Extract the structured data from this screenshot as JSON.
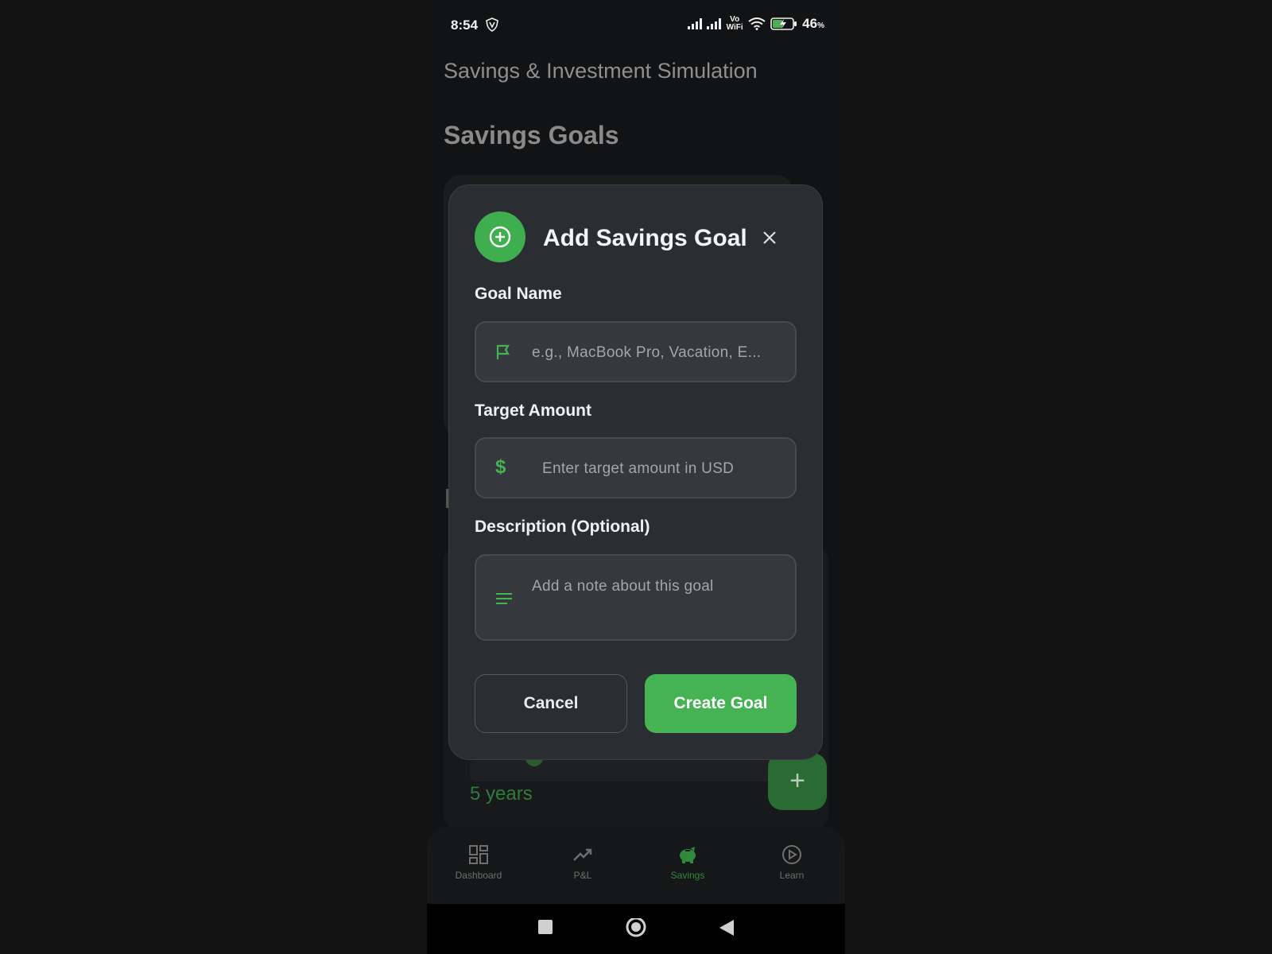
{
  "status_bar": {
    "time": "8:54",
    "battery": "46",
    "battery_unit": "%",
    "network": "Vo WiFi"
  },
  "page": {
    "title": "Savings & Investment Simulation",
    "section_title": "Savings Goals",
    "background_duration": "5 years"
  },
  "modal": {
    "title": "Add Savings Goal",
    "goal_name_label": "Goal Name",
    "goal_name_placeholder": "e.g., MacBook Pro, Vacation, E...",
    "target_amount_label": "Target Amount",
    "target_amount_placeholder": "Enter target amount in USD",
    "description_label": "Description (Optional)",
    "description_placeholder": "Add a note about this goal",
    "cancel_label": "Cancel",
    "create_label": "Create Goal"
  },
  "bottom_nav": {
    "items": [
      {
        "label": "Dashboard",
        "icon": "dashboard-icon",
        "active": false
      },
      {
        "label": "P&L",
        "icon": "trending-up-icon",
        "active": false
      },
      {
        "label": "Savings",
        "icon": "piggy-bank-icon",
        "active": true
      },
      {
        "label": "Learn",
        "icon": "play-circle-icon",
        "active": false
      }
    ]
  },
  "colors": {
    "accent": "#45b354",
    "modal_bg": "#2a2d31",
    "background": "#121314"
  }
}
